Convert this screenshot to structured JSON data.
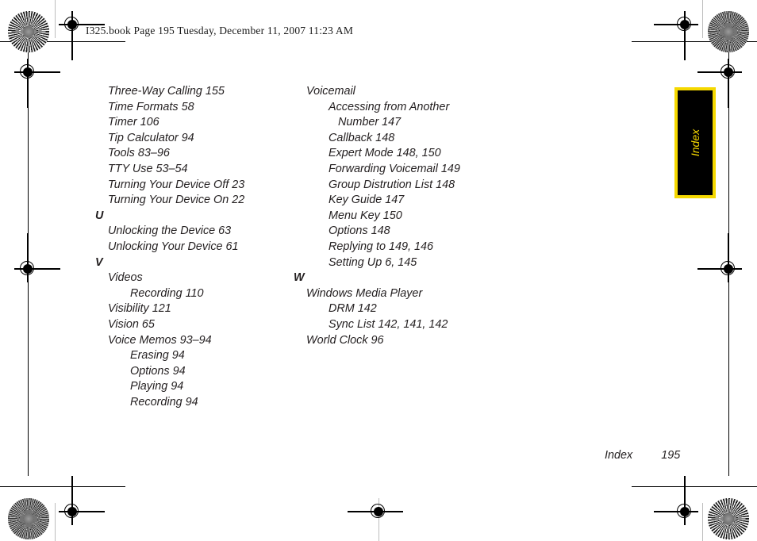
{
  "header": {
    "book_line": "I325.book  Page 195  Tuesday, December 11, 2007  11:23 AM"
  },
  "side_tab": {
    "label": "Index",
    "background_color": "#000000",
    "border_color": "#f5d800",
    "text_color": "#f5d800"
  },
  "footer": {
    "section": "Index",
    "page_number": "195"
  },
  "index": {
    "left_column": [
      {
        "level": "lvl1",
        "text": "Three-Way Calling 155"
      },
      {
        "level": "lvl1",
        "text": "Time Formats 58"
      },
      {
        "level": "lvl1",
        "text": "Timer 106"
      },
      {
        "level": "lvl1",
        "text": "Tip Calculator 94"
      },
      {
        "level": "lvl1",
        "text": "Tools 83–96"
      },
      {
        "level": "lvl1",
        "text": "TTY Use 53–54"
      },
      {
        "level": "lvl1",
        "text": "Turning Your Device Off 23"
      },
      {
        "level": "lvl1",
        "text": "Turning Your Device On 22"
      },
      {
        "level": "letter",
        "text": "U"
      },
      {
        "level": "lvl1",
        "text": "Unlocking the Device 63"
      },
      {
        "level": "lvl1",
        "text": "Unlocking Your Device 61"
      },
      {
        "level": "letter",
        "text": "V"
      },
      {
        "level": "lvl1",
        "text": "Videos"
      },
      {
        "level": "lvl2",
        "text": "Recording 110"
      },
      {
        "level": "lvl1",
        "text": "Visibility 121"
      },
      {
        "level": "lvl1",
        "text": "Vision 65"
      },
      {
        "level": "lvl1",
        "text": "Voice Memos 93–94"
      },
      {
        "level": "lvl2",
        "text": "Erasing 94"
      },
      {
        "level": "lvl2",
        "text": "Options 94"
      },
      {
        "level": "lvl2",
        "text": "Playing 94"
      },
      {
        "level": "lvl2",
        "text": "Recording 94"
      }
    ],
    "right_column": [
      {
        "level": "lvl1",
        "text": "Voicemail"
      },
      {
        "level": "lvl2",
        "text": "Accessing from Another"
      },
      {
        "level": "lvl3",
        "text": "Number 147"
      },
      {
        "level": "lvl2",
        "text": "Callback 148"
      },
      {
        "level": "lvl2",
        "text": "Expert Mode 148, 150"
      },
      {
        "level": "lvl2",
        "text": "Forwarding Voicemail 149"
      },
      {
        "level": "lvl2",
        "text": "Group Distrution List 148"
      },
      {
        "level": "lvl2",
        "text": "Key Guide 147"
      },
      {
        "level": "lvl2",
        "text": "Menu Key 150"
      },
      {
        "level": "lvl2",
        "text": "Options 148"
      },
      {
        "level": "lvl2",
        "text": "Replying to 149, 146"
      },
      {
        "level": "lvl2",
        "text": "Setting Up 6, 145"
      },
      {
        "level": "letter",
        "text": "W"
      },
      {
        "level": "lvl1",
        "text": "Windows Media Player"
      },
      {
        "level": "lvl2",
        "text": "DRM 142"
      },
      {
        "level": "lvl2",
        "text": "Sync List 142, 141, 142"
      },
      {
        "level": "lvl1",
        "text": "World Clock 96"
      }
    ]
  }
}
